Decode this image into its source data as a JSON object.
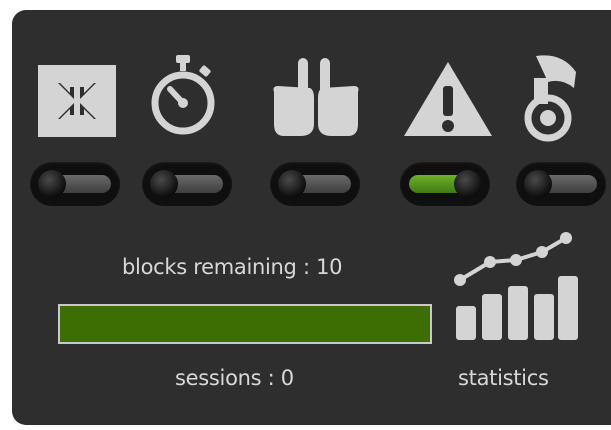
{
  "toggles": [
    {
      "icon": "shrink-arrows-icon",
      "state": "off"
    },
    {
      "icon": "stopwatch-icon",
      "state": "off"
    },
    {
      "icon": "hands-pointing-icon",
      "state": "off"
    },
    {
      "icon": "warning-icon",
      "state": "on"
    },
    {
      "icon": "french-horn-icon",
      "state": "off"
    }
  ],
  "blocks": {
    "label": "blocks remaining : 10"
  },
  "progress": {
    "fraction": 1.0,
    "fill_color": "#3d6e04"
  },
  "sessions": {
    "label": "sessions : 0"
  },
  "statistics": {
    "label": "statistics",
    "icon": "statistics-chart-icon"
  },
  "colors": {
    "panel": "#2e2e2e",
    "icon": "#d4d4d4",
    "toggle_on": "#5c9a1e",
    "text": "#d8d8d8"
  }
}
